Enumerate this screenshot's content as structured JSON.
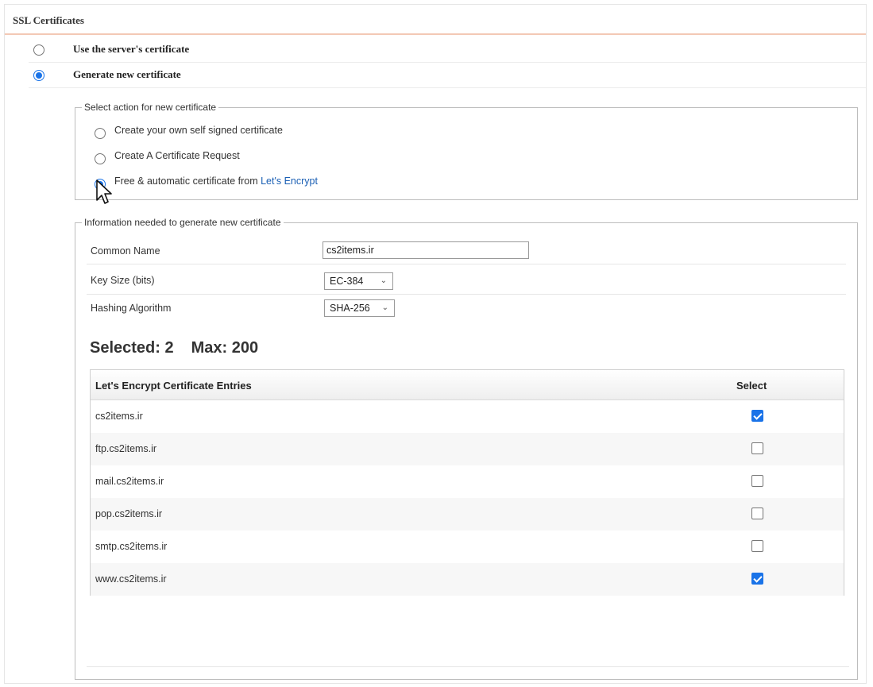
{
  "panel": {
    "title": "SSL Certificates"
  },
  "options": {
    "use_server": {
      "label": "Use the server's certificate",
      "checked": false
    },
    "generate_new": {
      "label": "Generate new certificate",
      "checked": true
    }
  },
  "action": {
    "legend": "Select action for new certificate",
    "self_signed": {
      "label": "Create your own self signed certificate",
      "checked": false
    },
    "request": {
      "label": "Create A Certificate Request",
      "checked": false
    },
    "lets_encrypt": {
      "label_prefix": "Free & automatic certificate from ",
      "link": "Let's Encrypt",
      "checked": true
    }
  },
  "info": {
    "legend": "Information needed to generate new certificate",
    "common_name": {
      "label": "Common Name",
      "value": "cs2items.ir"
    },
    "key_size": {
      "label": "Key Size (bits)",
      "value": "EC-384"
    },
    "hashing": {
      "label": "Hashing Algorithm",
      "value": "SHA-256"
    }
  },
  "counter": {
    "selected": "Selected: 2",
    "max": "Max: 200"
  },
  "table": {
    "col_entries": "Let's Encrypt Certificate Entries",
    "col_select": "Select",
    "rows": [
      {
        "name": "cs2items.ir",
        "checked": true
      },
      {
        "name": "ftp.cs2items.ir",
        "checked": false
      },
      {
        "name": "mail.cs2items.ir",
        "checked": false
      },
      {
        "name": "pop.cs2items.ir",
        "checked": false
      },
      {
        "name": "smtp.cs2items.ir",
        "checked": false
      },
      {
        "name": "www.cs2items.ir",
        "checked": true
      }
    ]
  },
  "icons": {
    "chevron": "chevron-down-icon",
    "cursor": "mouse-pointer-icon"
  },
  "colors": {
    "accent": "#1a73e8",
    "header_rule": "#f3c9b5",
    "link": "#1a5fb4"
  }
}
